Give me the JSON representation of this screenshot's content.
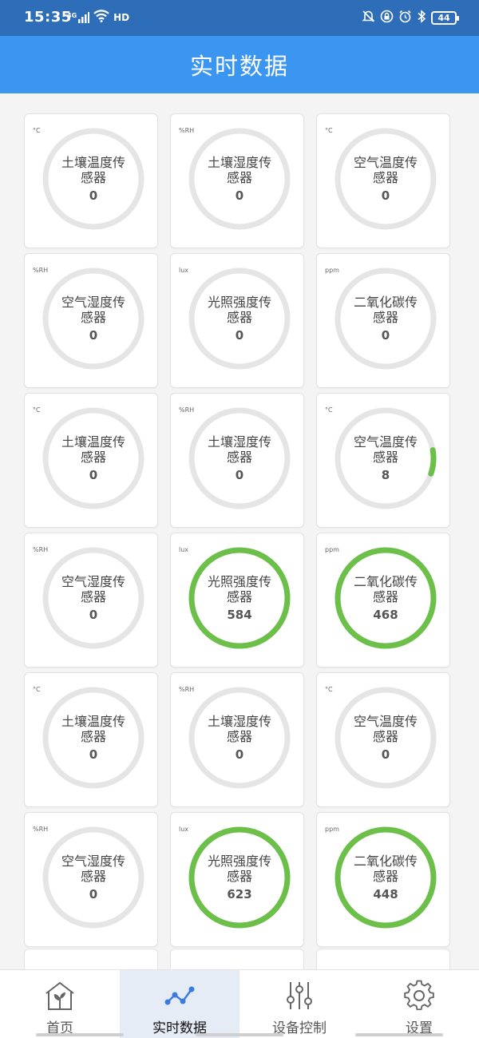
{
  "status_bar": {
    "time": "15:35",
    "network": "4G",
    "hd": "HD",
    "battery": "44"
  },
  "header": {
    "title": "实时数据"
  },
  "colors": {
    "status_bar": "#2e6db8",
    "header": "#3b96f1",
    "gauge_track": "#e5e5e5",
    "gauge_active": "#6cc04a"
  },
  "sensors": [
    {
      "unit": "°C",
      "label": "土壤温度传感器",
      "value": "0",
      "progress": 0
    },
    {
      "unit": "%RH",
      "label": "土壤湿度传感器",
      "value": "0",
      "progress": 0
    },
    {
      "unit": "°C",
      "label": "空气温度传感器",
      "value": "0",
      "progress": 0
    },
    {
      "unit": "%RH",
      "label": "空气湿度传感器",
      "value": "0",
      "progress": 0
    },
    {
      "unit": "lux",
      "label": "光照强度传感器",
      "value": "0",
      "progress": 0
    },
    {
      "unit": "ppm",
      "label": "二氧化碳传感器",
      "value": "0",
      "progress": 0
    },
    {
      "unit": "°C",
      "label": "土壤温度传感器",
      "value": "0",
      "progress": 0
    },
    {
      "unit": "%RH",
      "label": "土壤湿度传感器",
      "value": "0",
      "progress": 0
    },
    {
      "unit": "°C",
      "label": "空气温度传感器",
      "value": "8",
      "progress": 0.08
    },
    {
      "unit": "%RH",
      "label": "空气湿度传感器",
      "value": "0",
      "progress": 0
    },
    {
      "unit": "lux",
      "label": "光照强度传感器",
      "value": "584",
      "progress": 1
    },
    {
      "unit": "ppm",
      "label": "二氧化碳传感器",
      "value": "468",
      "progress": 1
    },
    {
      "unit": "°C",
      "label": "土壤温度传感器",
      "value": "0",
      "progress": 0
    },
    {
      "unit": "%RH",
      "label": "土壤湿度传感器",
      "value": "0",
      "progress": 0
    },
    {
      "unit": "°C",
      "label": "空气温度传感器",
      "value": "0",
      "progress": 0
    },
    {
      "unit": "%RH",
      "label": "空气湿度传感器",
      "value": "0",
      "progress": 0
    },
    {
      "unit": "lux",
      "label": "光照强度传感器",
      "value": "623",
      "progress": 1
    },
    {
      "unit": "ppm",
      "label": "二氧化碳传感器",
      "value": "448",
      "progress": 1
    }
  ],
  "nav": [
    {
      "label": "首页",
      "icon": "home-plant-icon",
      "active": false
    },
    {
      "label": "实时数据",
      "icon": "line-chart-icon",
      "active": true
    },
    {
      "label": "设备控制",
      "icon": "sliders-icon",
      "active": false
    },
    {
      "label": "设置",
      "icon": "gear-icon",
      "active": false
    }
  ]
}
